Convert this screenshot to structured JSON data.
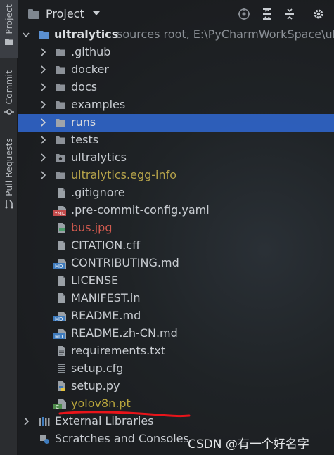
{
  "tool_strip": {
    "tabs": [
      {
        "label": "Project",
        "icon": "folder-icon",
        "active": true
      },
      {
        "label": "Commit",
        "icon": "commit-icon",
        "active": false
      },
      {
        "label": "Pull Requests",
        "icon": "pull-request-icon",
        "active": false
      }
    ]
  },
  "header": {
    "title": "Project",
    "buttons": [
      "locate-icon",
      "expand-all-icon",
      "collapse-all-icon",
      "gear-icon"
    ]
  },
  "tree": {
    "root": {
      "label": "ultralytics",
      "hint": "sources root,  E:\\PyCharmWorkSpace\\ult"
    },
    "items": [
      {
        "label": ".github",
        "type": "folder",
        "status": "normal"
      },
      {
        "label": "docker",
        "type": "folder",
        "status": "normal"
      },
      {
        "label": "docs",
        "type": "folder",
        "status": "normal"
      },
      {
        "label": "examples",
        "type": "folder",
        "status": "normal"
      },
      {
        "label": "runs",
        "type": "folder",
        "status": "selected"
      },
      {
        "label": "tests",
        "type": "folder",
        "status": "normal"
      },
      {
        "label": "ultralytics",
        "type": "package",
        "status": "normal"
      },
      {
        "label": "ultralytics.egg-info",
        "type": "folder",
        "status": "ignored"
      },
      {
        "label": ".gitignore",
        "type": "file",
        "status": "normal"
      },
      {
        "label": ".pre-commit-config.yaml",
        "type": "yaml",
        "status": "normal"
      },
      {
        "label": "bus.jpg",
        "type": "image",
        "status": "unversioned"
      },
      {
        "label": "CITATION.cff",
        "type": "file",
        "status": "normal"
      },
      {
        "label": "CONTRIBUTING.md",
        "type": "markdown",
        "status": "normal"
      },
      {
        "label": "LICENSE",
        "type": "file",
        "status": "normal"
      },
      {
        "label": "MANIFEST.in",
        "type": "file",
        "status": "normal"
      },
      {
        "label": "README.md",
        "type": "markdown",
        "status": "normal"
      },
      {
        "label": "README.zh-CN.md",
        "type": "markdown",
        "status": "normal"
      },
      {
        "label": "requirements.txt",
        "type": "file",
        "status": "normal"
      },
      {
        "label": "setup.cfg",
        "type": "config",
        "status": "normal"
      },
      {
        "label": "setup.py",
        "type": "python",
        "status": "normal"
      },
      {
        "label": "yolov8n.pt",
        "type": "binary",
        "status": "added"
      }
    ],
    "external_libraries": "External Libraries",
    "scratches": "Scratches and Consoles"
  },
  "icon_badges": {
    "yaml": "YML",
    "markdown": "MD",
    "binary": "C"
  },
  "colors": {
    "selection": "#2f65ca",
    "ignored_text": "#b6a34a",
    "unversioned_text": "#d15a4f",
    "annotation_red": "#e8141a"
  },
  "watermark": "CSDN @有一个好名字"
}
